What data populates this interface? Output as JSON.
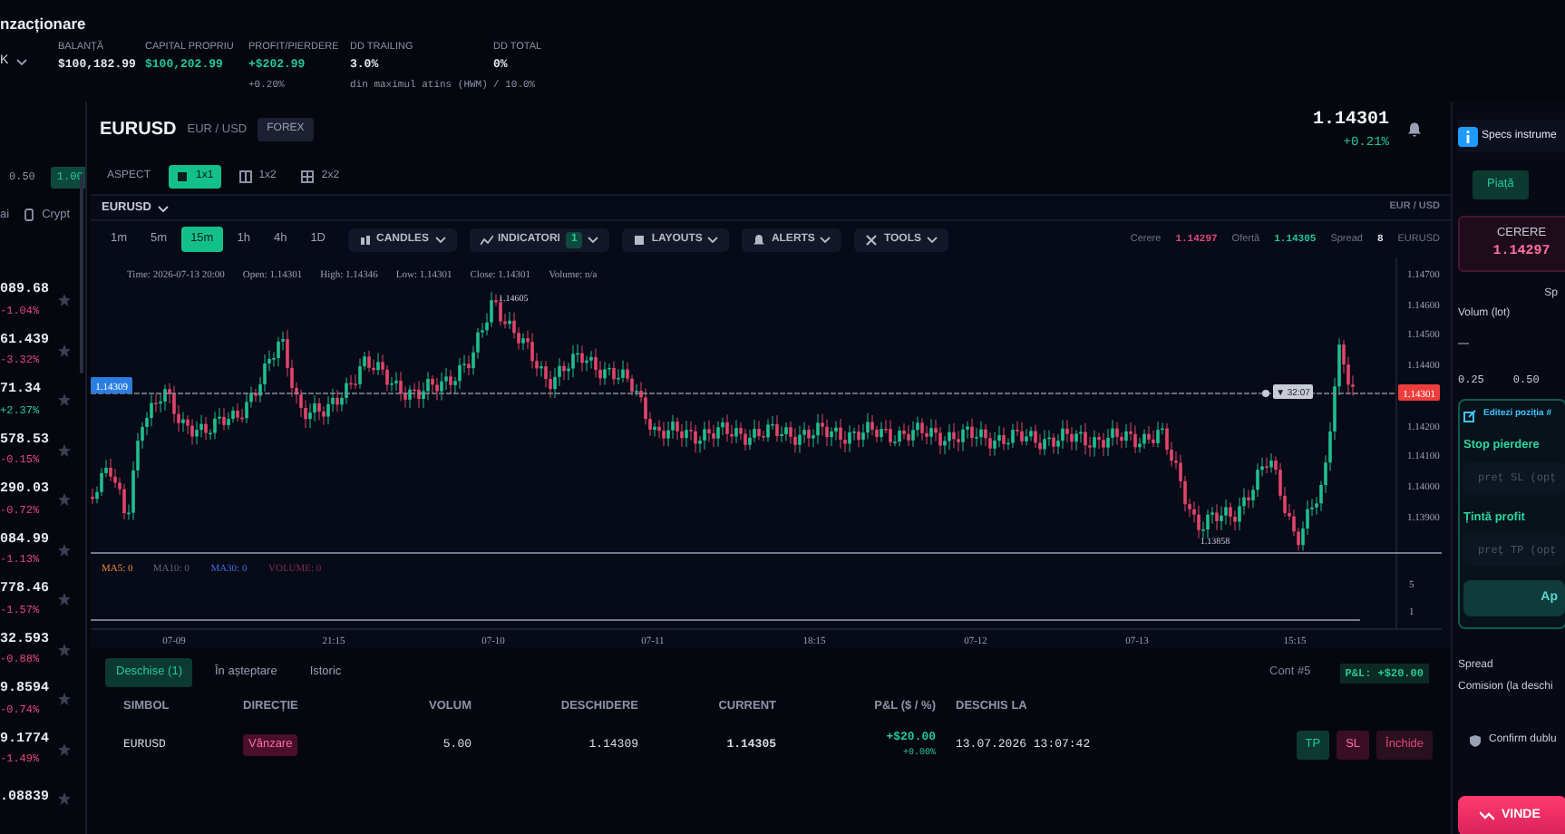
{
  "app": {
    "title": "nzacționare",
    "account_selector": "K"
  },
  "stats": [
    {
      "label": "BALANȚĂ",
      "value": "$100,182.99",
      "positive": false
    },
    {
      "label": "CAPITAL PROPRIU",
      "value": "$100,202.99",
      "positive": true
    },
    {
      "label": "PROFIT/PIERDERE",
      "value": "+$202.99",
      "sub": "+0.20%",
      "positive": true
    },
    {
      "label": "DD TRAILING",
      "value": "3.0%",
      "sub": "din maximul atins (HWM)",
      "positive": false
    },
    {
      "label": "DD TOTAL",
      "value": "0%",
      "sub": "/ 10.0%",
      "positive": false
    }
  ],
  "watchlist": {
    "lot_options": [
      {
        "label": "0.50",
        "selected": false
      },
      {
        "label": "1.00",
        "selected": true
      }
    ],
    "categories": [
      {
        "label": "ai",
        "kind": "plain"
      },
      {
        "label": "Crypt",
        "kind": "crypto"
      }
    ],
    "rows": [
      {
        "price": "089.68",
        "change": "-1.04%",
        "negative": true
      },
      {
        "price": "61.439",
        "change": "-3.32%",
        "negative": true
      },
      {
        "price": "71.34",
        "change": "+2.37%",
        "negative": false
      },
      {
        "price": "578.53",
        "change": "-0.15%",
        "negative": true
      },
      {
        "price": "290.03",
        "change": "-0.72%",
        "negative": true
      },
      {
        "price": "084.99",
        "change": "-1.13%",
        "negative": true
      },
      {
        "price": "778.46",
        "change": "-1.57%",
        "negative": true
      },
      {
        "price": "32.593",
        "change": "-0.88%",
        "negative": true
      },
      {
        "price": "9.8594",
        "change": "-0.74%",
        "negative": true
      },
      {
        "price": "9.1774",
        "change": "-1.49%",
        "negative": true
      },
      {
        "price": ".08839"
      }
    ]
  },
  "instrument": {
    "symbol": "EURUSD",
    "pair": "EUR / USD",
    "market": "FOREX",
    "price": "1.14301",
    "change": "+0.21%"
  },
  "aspect": {
    "label": "ASPECT",
    "options": [
      {
        "label": "1x1",
        "selected": true
      },
      {
        "label": "1x2",
        "selected": false
      },
      {
        "label": "2x2",
        "selected": false
      }
    ]
  },
  "chart_panel": {
    "symbol_select": "EURUSD",
    "pair_hint": "EUR / USD",
    "timeframes": [
      {
        "label": "1m",
        "selected": false
      },
      {
        "label": "5m",
        "selected": false
      },
      {
        "label": "15m",
        "selected": true
      },
      {
        "label": "1h",
        "selected": false
      },
      {
        "label": "4h",
        "selected": false
      },
      {
        "label": "1D",
        "selected": false
      }
    ],
    "tools": [
      {
        "label": "CANDLES",
        "kind": "candles"
      },
      {
        "label": "INDICATORI",
        "kind": "indicators",
        "badge": "1"
      },
      {
        "label": "LAYOUTS",
        "kind": "layouts"
      },
      {
        "label": "ALERTS",
        "kind": "alerts"
      },
      {
        "label": "TOOLS",
        "kind": "tools"
      }
    ],
    "quote": [
      {
        "label": "Cerere",
        "value": "1.14297",
        "color": "#e0487a"
      },
      {
        "label": "Ofertă",
        "value": "1.14305",
        "color": "#22c996"
      },
      {
        "label": "Spread",
        "value": "8",
        "color": "#e6e8ef"
      }
    ],
    "quote_symbol": "EURUSD",
    "ohlc": [
      "Time: 2026-07-13 20:00",
      "Open: 1.14301",
      "High: 1.14346",
      "Low: 1.14301",
      "Close: 1.14301",
      "Volume: n/a"
    ],
    "price_ticks": [
      "1.14700",
      "1.14600",
      "1.14500",
      "1.14400",
      "1.14200",
      "1.14100",
      "1.14000",
      "1.13900"
    ],
    "high_marker": "1.14605",
    "low_marker": "1.13858",
    "entry_label": "1.14309",
    "current_label": "1.14301",
    "countdown": "▼ 32:07",
    "volume_legend": [
      {
        "label": "MA5: 0",
        "color": "#e8893a"
      },
      {
        "label": "MA10: 0",
        "color": "#5f6580"
      },
      {
        "label": "MA30: 0",
        "color": "#3d6fe0"
      },
      {
        "label": "VOLUME: 0",
        "color": "#7c2f4d"
      }
    ],
    "volume_ticks": [
      "5",
      "1"
    ],
    "time_ticks": [
      "07-09",
      "21:15",
      "07-10",
      "07-11",
      "18:15",
      "07-12",
      "07-13",
      "15:15"
    ]
  },
  "positions": {
    "tabs": [
      {
        "label": "Deschise (1)",
        "selected": true
      },
      {
        "label": "În așteptare",
        "selected": false
      },
      {
        "label": "Istoric",
        "selected": false
      }
    ],
    "account": "Cont #5",
    "pnl": "P&L: +$20.00",
    "columns": [
      "SIMBOL",
      "DIRECȚIE",
      "VOLUM",
      "DESCHIDERE",
      "CURRENT",
      "P&L ($ / %)",
      "DESCHIS LA"
    ],
    "rows": [
      {
        "symbol": "EURUSD",
        "direction": "Vânzare",
        "volume": "5.00",
        "open": "1.14309",
        "current": "1.14305",
        "pnl": "+$20.00",
        "pnl_pct": "+0.00%",
        "opened_at": "13.07.2026 13:07:42",
        "actions": [
          {
            "label": "TP",
            "kind": "tp"
          },
          {
            "label": "SL",
            "kind": "sl"
          },
          {
            "label": "Închide",
            "kind": "close"
          }
        ]
      }
    ]
  },
  "order_panel": {
    "specs": "Specs instrume",
    "tabs": [
      {
        "label": "Piață",
        "selected": true
      }
    ],
    "bid_label": "CERERE",
    "bid": "1.14297",
    "spread_fragment": "Sp",
    "volume_label": "Volum (lot)",
    "stepper": "—",
    "lots": [
      "0.25",
      "0.50"
    ],
    "edit_title": "Editezi poziția #",
    "stop_label": "Stop pierdere",
    "stop_placeholder": "preț SL (opț",
    "target_label": "Țintă profit",
    "target_placeholder": "preț TP (opț",
    "apply": "Ap",
    "info_rows": [
      "Spread",
      "Comision (la deschi"
    ],
    "confirm": "Confirm dublu",
    "sell": "VINDE"
  }
}
